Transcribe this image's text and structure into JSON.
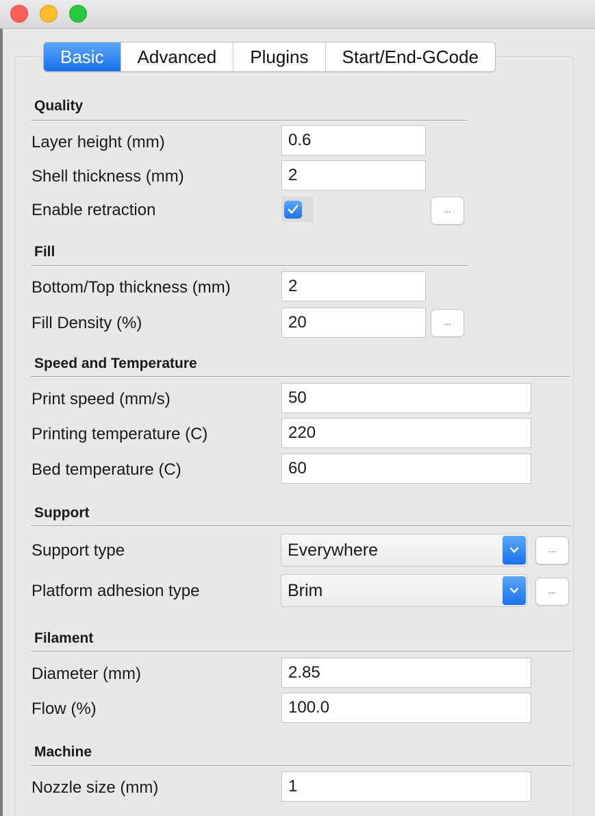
{
  "window": {
    "controls": [
      "close-button",
      "minimize-button",
      "zoom-button"
    ]
  },
  "tabs": [
    {
      "label": "Basic",
      "active": true
    },
    {
      "label": "Advanced",
      "active": false
    },
    {
      "label": "Plugins",
      "active": false
    },
    {
      "label": "Start/End-GCode",
      "active": false
    }
  ],
  "quality": {
    "heading": "Quality",
    "layer_height": {
      "label": "Layer height (mm)",
      "value": "0.6"
    },
    "shell_thickness": {
      "label": "Shell thickness (mm)",
      "value": "2"
    },
    "enable_retraction": {
      "label": "Enable retraction",
      "checked": true
    },
    "retraction_more": "..."
  },
  "fill": {
    "heading": "Fill",
    "bottom_top_thickness": {
      "label": "Bottom/Top thickness (mm)",
      "value": "2"
    },
    "fill_density": {
      "label": "Fill Density (%)",
      "value": "20"
    },
    "fill_more": "..."
  },
  "speed": {
    "heading": "Speed and Temperature",
    "print_speed": {
      "label": "Print speed (mm/s)",
      "value": "50"
    },
    "printing_temperature": {
      "label": "Printing temperature (C)",
      "value": "220"
    },
    "bed_temperature": {
      "label": "Bed temperature (C)",
      "value": "60"
    }
  },
  "support": {
    "heading": "Support",
    "support_type": {
      "label": "Support type",
      "value": "Everywhere"
    },
    "support_more": "...",
    "platform_adhesion": {
      "label": "Platform adhesion type",
      "value": "Brim"
    },
    "adhesion_more": "..."
  },
  "filament": {
    "heading": "Filament",
    "diameter": {
      "label": "Diameter (mm)",
      "value": "2.85"
    },
    "flow": {
      "label": "Flow (%)",
      "value": "100.0"
    }
  },
  "machine": {
    "heading": "Machine",
    "nozzle_size": {
      "label": "Nozzle size (mm)",
      "value": "1"
    }
  },
  "colors": {
    "accent": "#1a72ec",
    "close": "#fc5f57",
    "minimize": "#fdbc2e",
    "zoom": "#2ac840"
  }
}
